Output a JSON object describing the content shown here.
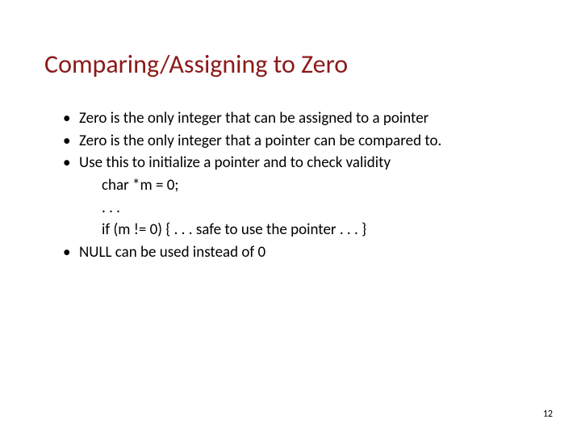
{
  "slide": {
    "title": "Comparing/Assigning to Zero",
    "bullets": {
      "b1": "Zero is the only integer that can be assigned to a pointer",
      "b2": "Zero is the only integer that a pointer can be compared to.",
      "b3": "Use this to initialize a pointer and to check validity",
      "b3_line1": "char *m = 0;",
      "b3_line2": ". . .",
      "b3_line3": "if (m != 0) { . . . safe to use the pointer . . . }",
      "b4": "NULL can be used instead of 0"
    },
    "page_number": "12"
  }
}
